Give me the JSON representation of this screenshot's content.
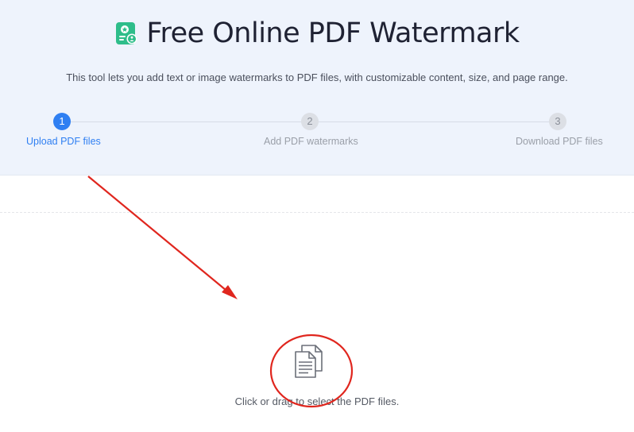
{
  "header": {
    "title": "Free Online PDF Watermark",
    "subtitle": "This tool lets you add text or image watermarks to PDF files, with customizable content, size, and page range.",
    "logo_icon": "pdf-watermark-logo-icon",
    "brand_color": "#2ebd8a"
  },
  "steps": [
    {
      "number": "1",
      "label": "Upload PDF files",
      "state": "active"
    },
    {
      "number": "2",
      "label": "Add PDF watermarks",
      "state": "inactive"
    },
    {
      "number": "3",
      "label": "Download PDF files",
      "state": "inactive"
    }
  ],
  "upload": {
    "icon": "documents-icon",
    "instruction": "Click or drag to select the PDF files."
  },
  "colors": {
    "accent": "#2f7ff2",
    "hero_background": "#eef3fc",
    "annotation": "#e0261e"
  }
}
